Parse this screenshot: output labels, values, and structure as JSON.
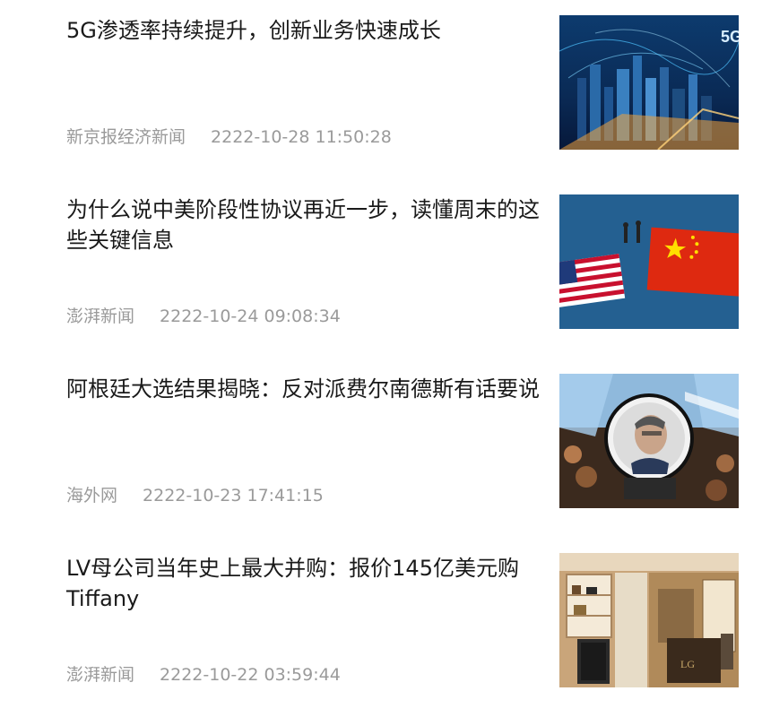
{
  "news": [
    {
      "title": "5G渗透率持续提升，创新业务快速成长",
      "source": "新京报经济新闻",
      "time": "2222-10-28 11:50:28",
      "thumb_icon": "5g-city-skyline-image"
    },
    {
      "title": "为什么说中美阶段性协议再近一步，读懂周末的这些关键信息",
      "source": "澎湃新闻",
      "time": "2222-10-24 09:08:34",
      "thumb_icon": "us-china-flags-image"
    },
    {
      "title": "阿根廷大选结果揭晓：反对派费尔南德斯有话要说",
      "source": "海外网",
      "time": "2222-10-23 17:41:15",
      "thumb_icon": "argentina-crowd-drum-image"
    },
    {
      "title": "LV母公司当年史上最大并购：报价145亿美元购Tiffany",
      "source": "澎湃新闻",
      "time": "2222-10-22 03:59:44",
      "thumb_icon": "luxury-store-interior-image"
    }
  ],
  "thumb_texts": {
    "fiveg": "5G",
    "lg": "LG"
  },
  "colors": {
    "title": "#1a1a1a",
    "meta": "#9a9a9a"
  }
}
